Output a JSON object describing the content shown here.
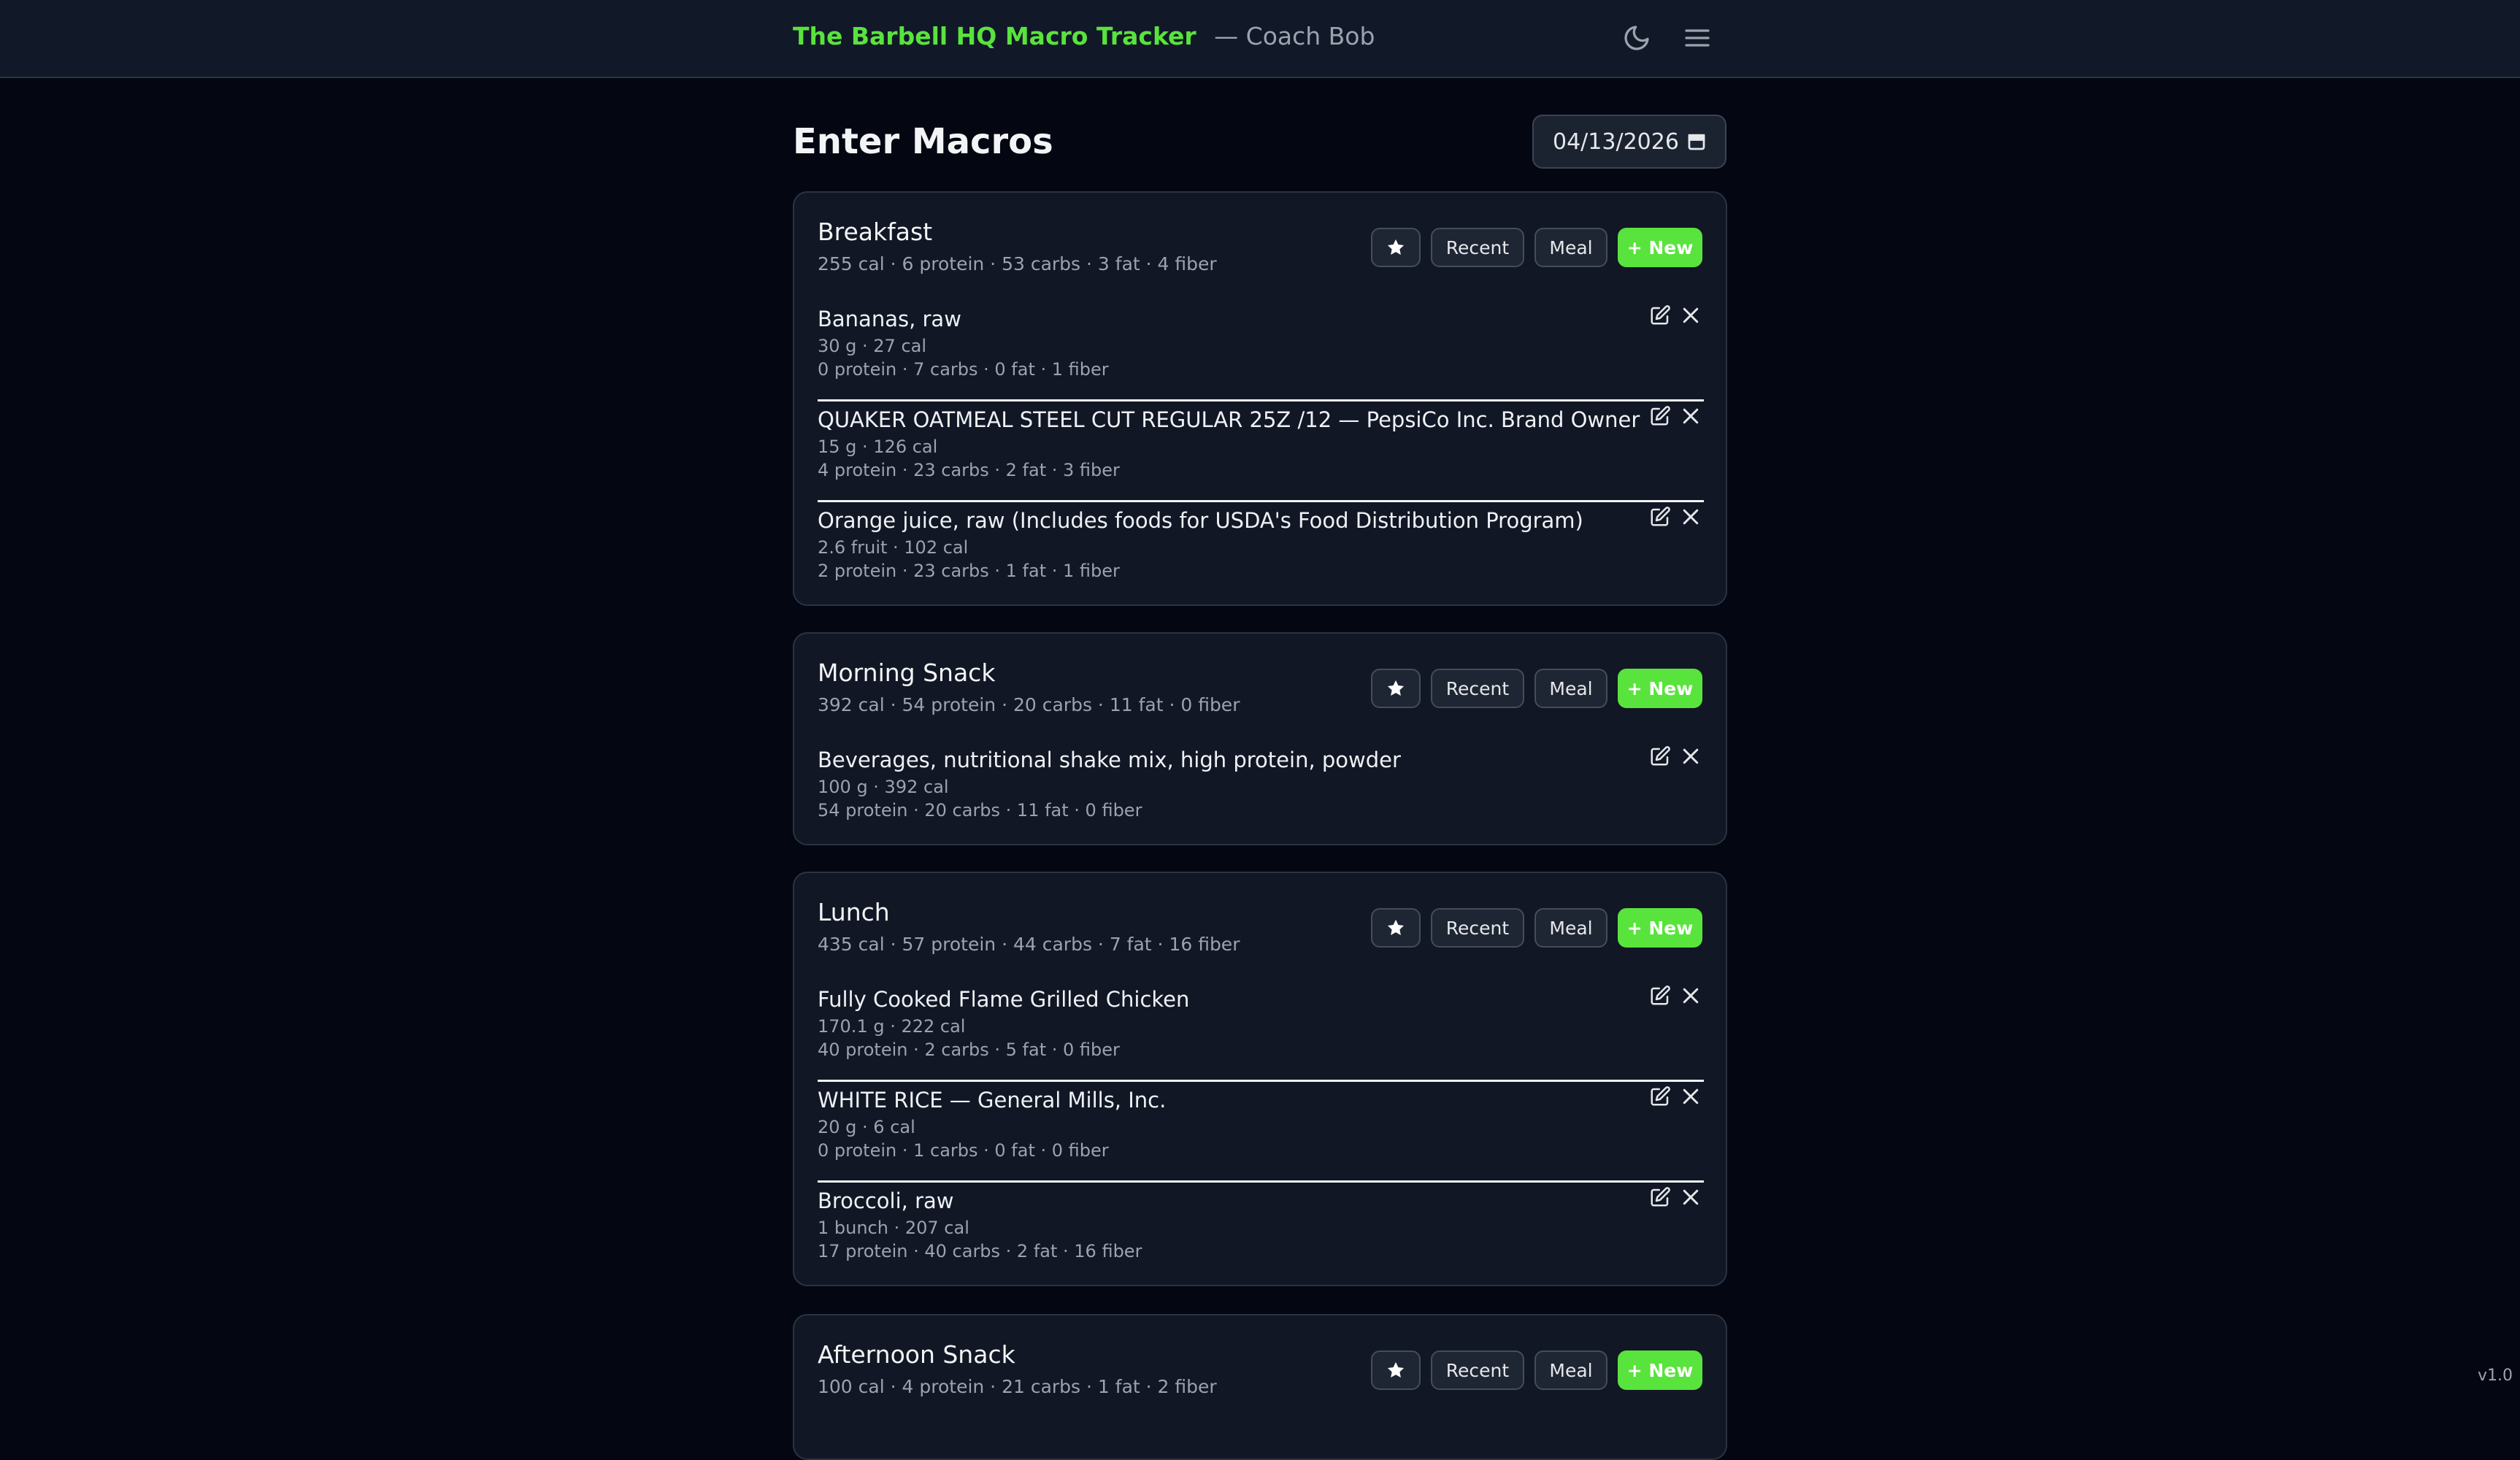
{
  "header": {
    "app_name": "The Barbell HQ Macro Tracker",
    "coach": "— Coach Bob",
    "icons": [
      "moon-icon",
      "hamburger-menu-icon"
    ]
  },
  "page": {
    "title": "Enter Macros",
    "date_value": "04/13/2026"
  },
  "buttons": {
    "recent": "Recent",
    "meal": "Meal",
    "new": "+ New"
  },
  "colors": {
    "accent": "#59e33d",
    "background": "#040712",
    "header_bg": "#111827",
    "card_bg": "#111724"
  },
  "meals": [
    {
      "title": "Breakfast",
      "summary": "255 cal · 6 protein · 53 carbs · 3 fat · 4 fiber",
      "items": [
        {
          "name": "Bananas, raw",
          "serving": "30 g · 27 cal",
          "macros": "0 protein · 7 carbs · 0 fat · 1 fiber"
        },
        {
          "name": "QUAKER OATMEAL STEEL CUT REGULAR 25Z /12 — PepsiCo Inc. Brand Owner",
          "serving": "15 g · 126 cal",
          "macros": "4 protein · 23 carbs · 2 fat · 3 fiber"
        },
        {
          "name": "Orange juice, raw (Includes foods for USDA's Food Distribution Program)",
          "serving": "2.6 fruit · 102 cal",
          "macros": "2 protein · 23 carbs · 1 fat · 1 fiber"
        }
      ]
    },
    {
      "title": "Morning Snack",
      "summary": "392 cal · 54 protein · 20 carbs · 11 fat · 0 fiber",
      "items": [
        {
          "name": "Beverages, nutritional shake mix, high protein, powder",
          "serving": "100 g · 392 cal",
          "macros": "54 protein · 20 carbs · 11 fat · 0 fiber"
        }
      ]
    },
    {
      "title": "Lunch",
      "summary": "435 cal · 57 protein · 44 carbs · 7 fat · 16 fiber",
      "items": [
        {
          "name": "Fully Cooked Flame Grilled Chicken",
          "serving": "170.1 g · 222 cal",
          "macros": "40 protein · 2 carbs · 5 fat · 0 fiber"
        },
        {
          "name": "WHITE RICE — General Mills, Inc.",
          "serving": "20 g · 6 cal",
          "macros": "0 protein · 1 carbs · 0 fat · 0 fiber"
        },
        {
          "name": "Broccoli, raw",
          "serving": "1 bunch · 207 cal",
          "macros": "17 protein · 40 carbs · 2 fat · 16 fiber"
        }
      ]
    },
    {
      "title": "Afternoon Snack",
      "summary": "100 cal · 4 protein · 21 carbs · 1 fat · 2 fiber",
      "items": []
    }
  ],
  "footer": {
    "version": "v1.0"
  }
}
